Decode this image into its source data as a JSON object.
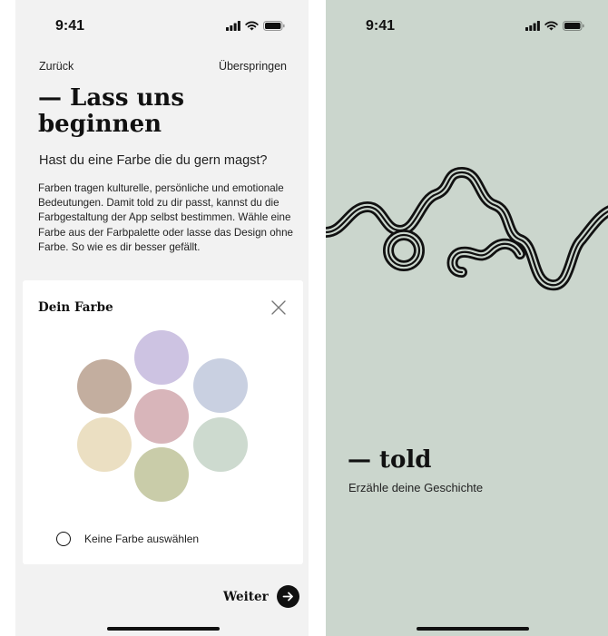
{
  "left_screen": {
    "status": {
      "time": "9:41"
    },
    "nav": {
      "back": "Zurück",
      "skip": "Überspringen"
    },
    "title": "— Lass uns beginnen",
    "question": "Hast du eine Farbe die du gern magst?",
    "body": "Farben tragen kulturelle, persönliche und emotionale Bedeutungen. Damit told zu dir passt, kannst du die Farbgestaltung der App selbst bestimmen. Wähle eine Farbe aus der Farbpalette oder lasse das Design ohne Farbe. So wie es dir besser gefällt.",
    "sheet": {
      "title": "Dein Farbe",
      "close_icon": "close-icon",
      "swatches": [
        {
          "name": "lavender",
          "color": "#cdc3e2"
        },
        {
          "name": "taupe",
          "color": "#c3ae9f"
        },
        {
          "name": "blue-grey",
          "color": "#c9d0e1"
        },
        {
          "name": "rose",
          "color": "#d8b5ba"
        },
        {
          "name": "sand",
          "color": "#ebdfc2"
        },
        {
          "name": "sage",
          "color": "#cddacf"
        },
        {
          "name": "olive",
          "color": "#c9cca9"
        }
      ],
      "no_color_label": "Keine Farbe auswählen"
    },
    "next_label": "Weiter",
    "next_icon": "arrow-right-icon"
  },
  "right_screen": {
    "status": {
      "time": "9:41"
    },
    "brand": "— told",
    "tagline": "Erzähle deine Geschichte",
    "background": "#cbd6cd"
  }
}
